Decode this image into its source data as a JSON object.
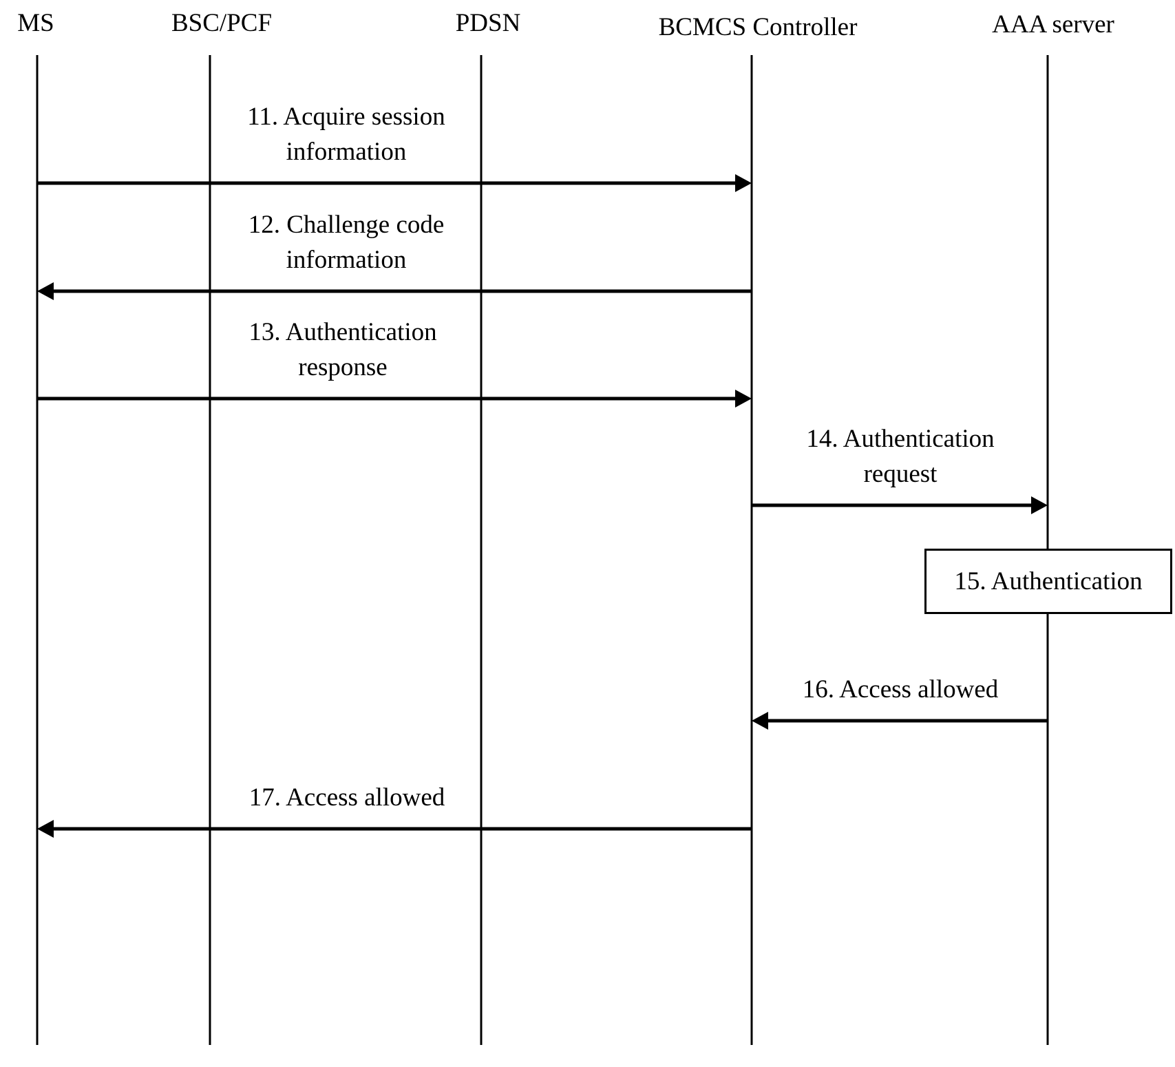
{
  "diagram": {
    "type": "sequence",
    "entities": [
      {
        "id": "ms",
        "label": "MS"
      },
      {
        "id": "bsc",
        "label": "BSC/PCF"
      },
      {
        "id": "pdsn",
        "label": "PDSN"
      },
      {
        "id": "bcmcs",
        "label": "BCMCS Controller"
      },
      {
        "id": "aaa",
        "label": "AAA server"
      }
    ],
    "messages": [
      {
        "step": 11,
        "from": "ms",
        "to": "bcmcs",
        "lines": [
          "11. Acquire session",
          "information"
        ]
      },
      {
        "step": 12,
        "from": "bcmcs",
        "to": "ms",
        "lines": [
          "12. Challenge code",
          "information"
        ]
      },
      {
        "step": 13,
        "from": "ms",
        "to": "bcmcs",
        "lines": [
          "13. Authentication",
          "response"
        ]
      },
      {
        "step": 14,
        "from": "bcmcs",
        "to": "aaa",
        "lines": [
          "14. Authentication",
          "request"
        ]
      },
      {
        "step": 16,
        "from": "aaa",
        "to": "bcmcs",
        "lines": [
          "16. Access allowed"
        ]
      },
      {
        "step": 17,
        "from": "bcmcs",
        "to": "ms",
        "lines": [
          "17. Access allowed"
        ]
      }
    ],
    "process": {
      "step": 15,
      "at": "aaa",
      "label": "15. Authentication"
    }
  }
}
